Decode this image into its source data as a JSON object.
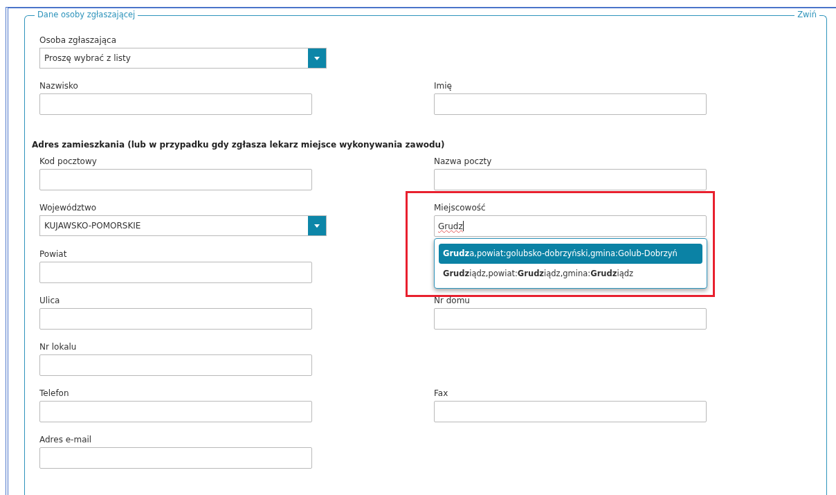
{
  "section": {
    "title": "Dane osoby zgłaszającej",
    "collapse_link": "Zwiń"
  },
  "groups": [
    {
      "rows": [
        [
          {
            "kind": "select",
            "label": "Osoba zgłaszająca",
            "value": "Proszę wybrać z listy"
          }
        ],
        [
          {
            "kind": "input",
            "label": "Nazwisko"
          },
          {
            "kind": "input",
            "label": "Imię"
          }
        ]
      ]
    },
    {
      "heading": "Adres zamieszkania (lub w przypadku gdy zgłasza lekarz miejsce wykonywania zawodu)",
      "rows": [
        [
          {
            "kind": "input",
            "label": "Kod pocztowy"
          },
          {
            "kind": "input",
            "label": "Nazwa poczty"
          }
        ],
        [
          {
            "kind": "select",
            "label": "Województwo",
            "value": "KUJAWSKO-POMORSKIE"
          },
          {
            "kind": "autocomplete",
            "label": "Miejscowość",
            "value": "Grudz",
            "highlighted": true,
            "suggestions": [
              {
                "text": "**Grudz**a,powiat:golubsko-dobrzyński,gmina:Golub-Dobrzyń",
                "selected": true
              },
              {
                "text": "**Grudz**iądz,powiat:**Grudz**iądz,gmina:**Grudz**iądz",
                "selected": false
              }
            ]
          }
        ],
        [
          {
            "kind": "input",
            "label": "Powiat"
          }
        ],
        [
          {
            "kind": "input",
            "label": "Ulica"
          },
          {
            "kind": "input",
            "label": "Nr domu"
          }
        ],
        [
          {
            "kind": "input",
            "label": "Nr lokalu"
          }
        ],
        [
          {
            "kind": "input",
            "label": "Telefon"
          },
          {
            "kind": "input",
            "label": "Fax"
          }
        ],
        [
          {
            "kind": "input",
            "label": "Adres e-mail"
          }
        ]
      ]
    }
  ]
}
